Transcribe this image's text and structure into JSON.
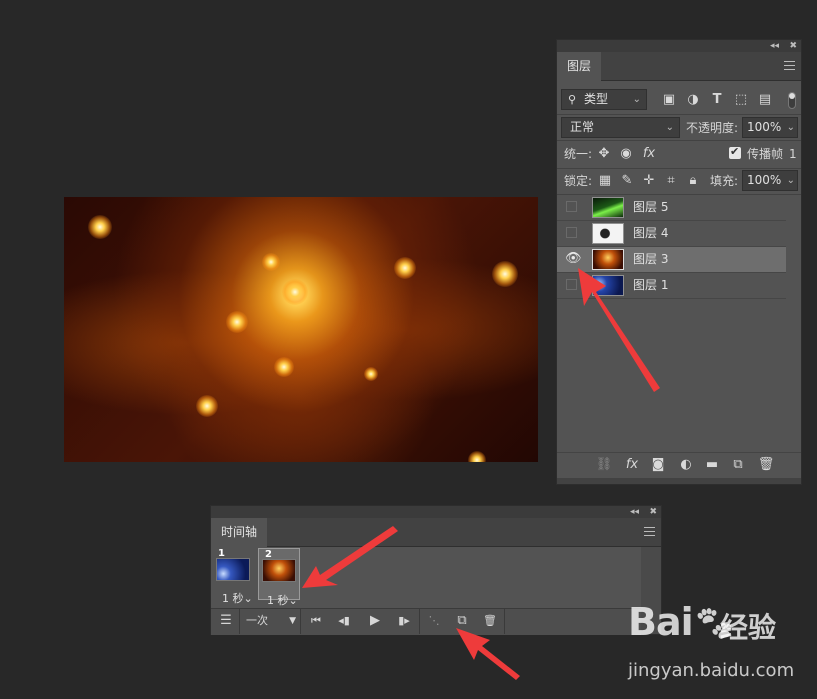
{
  "layers_panel": {
    "tab_label": "图层",
    "filter_kind": "类型",
    "blend_mode": "正常",
    "opacity_label": "不透明度:",
    "opacity_value": "100%",
    "unify_label": "统一:",
    "propagate_label": "传播帧",
    "propagate_value": "1",
    "lock_label": "锁定:",
    "fill_label": "填充:",
    "fill_value": "100%",
    "layers": [
      {
        "name": "图层 5",
        "visible": false,
        "selected": false
      },
      {
        "name": "图层 4",
        "visible": false,
        "selected": false
      },
      {
        "name": "图层 3",
        "visible": true,
        "selected": true
      },
      {
        "name": "图层 1",
        "visible": false,
        "selected": false
      }
    ]
  },
  "timeline_panel": {
    "tab_label": "时间轴",
    "frames": [
      {
        "number": "1",
        "delay": "1 秒"
      },
      {
        "number": "2",
        "delay": "1 秒"
      }
    ],
    "loop_option": "一次"
  },
  "watermark": {
    "brand": "Bai",
    "brand_suffix": "经验",
    "url": "jingyan.baidu.com"
  },
  "colors": {
    "panel_bg": "#535353",
    "selected_row": "#6e6e6e",
    "annotation_arrow": "#ee3b3b"
  }
}
